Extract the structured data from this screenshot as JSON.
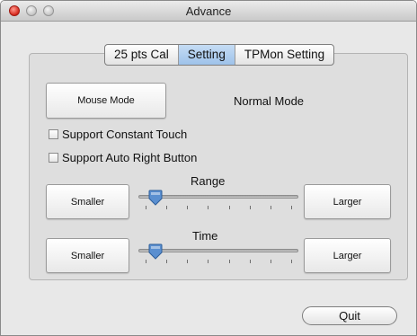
{
  "window": {
    "title": "Advance"
  },
  "tabs": [
    {
      "label": "25 pts Cal",
      "active": false
    },
    {
      "label": "Setting",
      "active": true
    },
    {
      "label": "TPMon Setting",
      "active": false
    }
  ],
  "mode": {
    "button_label": "Mouse Mode",
    "status_text": "Normal Mode"
  },
  "options": [
    {
      "label": "Support Constant Touch",
      "checked": false
    },
    {
      "label": "Support Auto Right Button",
      "checked": false
    }
  ],
  "range": {
    "title": "Range",
    "smaller_label": "Smaller",
    "larger_label": "Larger",
    "value": 0.07
  },
  "time": {
    "title": "Time",
    "smaller_label": "Smaller",
    "larger_label": "Larger",
    "value": 0.07
  },
  "footer": {
    "quit_label": "Quit"
  },
  "colors": {
    "accent": "#9ec2ea",
    "thumb": "#5a8fd0",
    "close_light": "#d6261b"
  }
}
